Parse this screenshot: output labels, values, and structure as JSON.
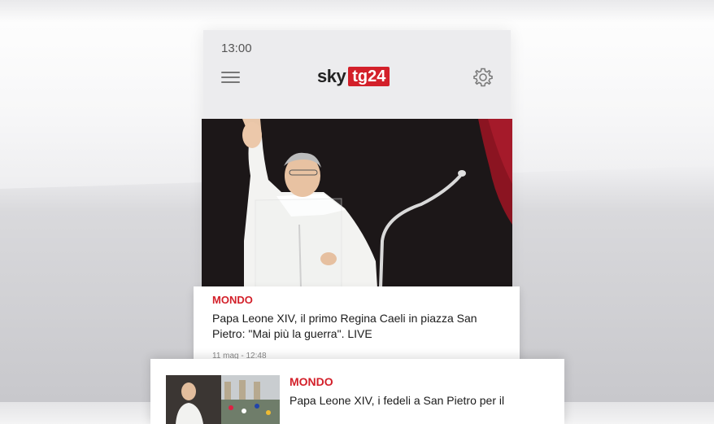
{
  "status_bar": {
    "time": "13:00"
  },
  "header": {
    "logo_sky": "sky",
    "logo_tg": "tg24",
    "menu_icon": "hamburger-menu-icon",
    "settings_icon": "gear-icon"
  },
  "hero_image": {
    "subject": "photo"
  },
  "articles": [
    {
      "category": "MONDO",
      "title": "Papa Leone XIV, il primo Regina Caeli in piazza San Pietro: \"Mai più la guerra\". LIVE",
      "date": "11 mag - 12:48"
    },
    {
      "category": "MONDO",
      "title": "Papa Leone XIV, i fedeli a San Pietro per il"
    }
  ],
  "colors": {
    "accent": "#d3202a",
    "background": "#ececee"
  }
}
